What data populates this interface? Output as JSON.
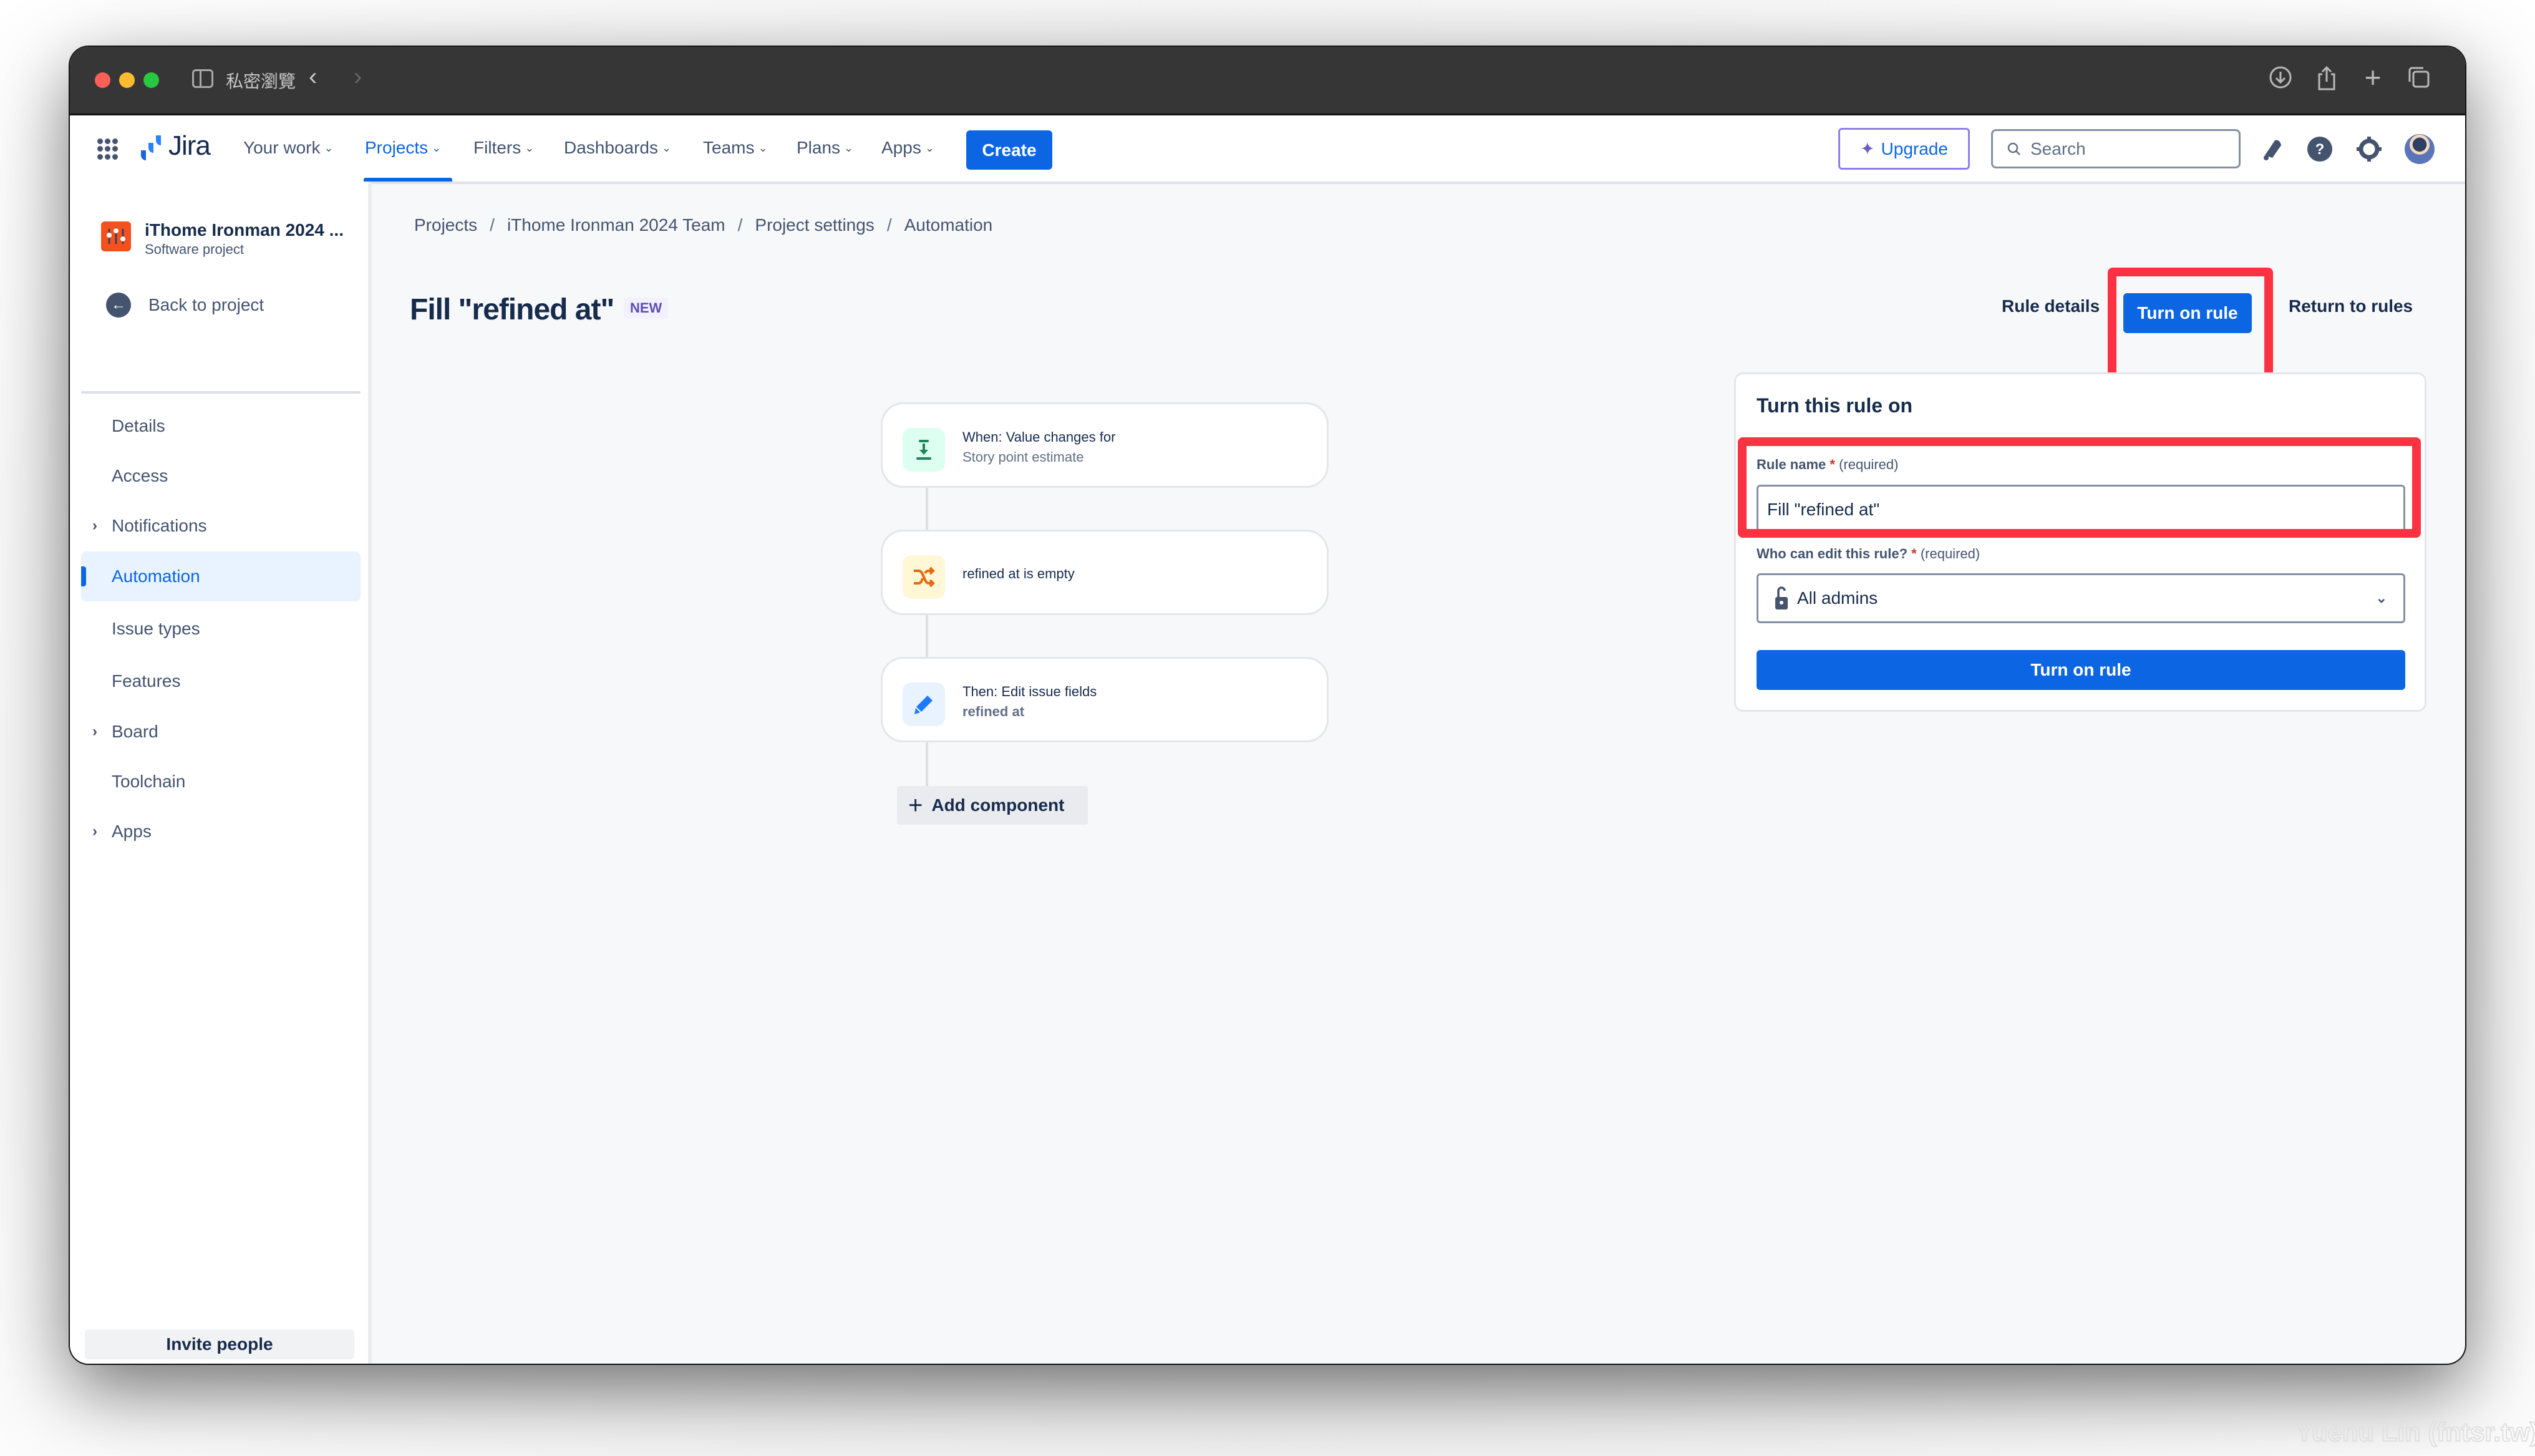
{
  "browser": {
    "tab_title": "私密瀏覽",
    "back_icon": "‹",
    "forward_icon": "›",
    "toolbar_icons": [
      "download-icon",
      "share-icon",
      "new-tab-icon",
      "tab-overview-icon"
    ]
  },
  "topnav": {
    "product": "Jira",
    "items": [
      {
        "label": "Your work",
        "active": false
      },
      {
        "label": "Projects",
        "active": true
      },
      {
        "label": "Filters",
        "active": false
      },
      {
        "label": "Dashboards",
        "active": false
      },
      {
        "label": "Teams",
        "active": false
      },
      {
        "label": "Plans",
        "active": false
      },
      {
        "label": "Apps",
        "active": false
      }
    ],
    "create_label": "Create",
    "upgrade_label": "Upgrade",
    "search_placeholder": "Search"
  },
  "sidebar": {
    "project_name": "iThome Ironman 2024 ...",
    "project_type": "Software project",
    "back_label": "Back to project",
    "items": [
      {
        "label": "Details",
        "expandable": false,
        "active": false
      },
      {
        "label": "Access",
        "expandable": false,
        "active": false
      },
      {
        "label": "Notifications",
        "expandable": true,
        "active": false
      },
      {
        "label": "Automation",
        "expandable": false,
        "active": true
      },
      {
        "label": "Issue types",
        "expandable": false,
        "active": false
      },
      {
        "label": "Features",
        "expandable": false,
        "active": false
      },
      {
        "label": "Board",
        "expandable": true,
        "active": false
      },
      {
        "label": "Toolchain",
        "expandable": false,
        "active": false
      },
      {
        "label": "Apps",
        "expandable": true,
        "active": false
      }
    ],
    "invite_label": "Invite people"
  },
  "breadcrumb": [
    "Projects",
    "iThome Ironman 2024 Team",
    "Project settings",
    "Automation"
  ],
  "page": {
    "title": "Fill \"refined at\"",
    "badge": "NEW",
    "rule_details_label": "Rule details",
    "turn_on_label": "Turn on rule",
    "return_label": "Return to rules"
  },
  "flow": {
    "trigger": {
      "title": "When: Value changes for",
      "subtitle": "Story point estimate"
    },
    "condition": {
      "title": "refined at is empty"
    },
    "action": {
      "title": "Then: Edit issue fields",
      "subtitle": "refined at"
    },
    "add_component_label": "Add component"
  },
  "turn_on_card": {
    "title": "Turn this rule on",
    "rule_name_label": "Rule name",
    "required_marker": "*",
    "required_text": "(required)",
    "rule_name_value": "Fill \"refined at\"",
    "editor_label": "Who can edit this rule?",
    "editor_value": "All admins",
    "submit_label": "Turn on rule"
  },
  "colors": {
    "brand": "#0c66e4",
    "highlight": "#fc3142",
    "text": "#172b4d",
    "subtle": "#44546f"
  },
  "watermark": "Yuehu Lin (fntsr.tw)"
}
